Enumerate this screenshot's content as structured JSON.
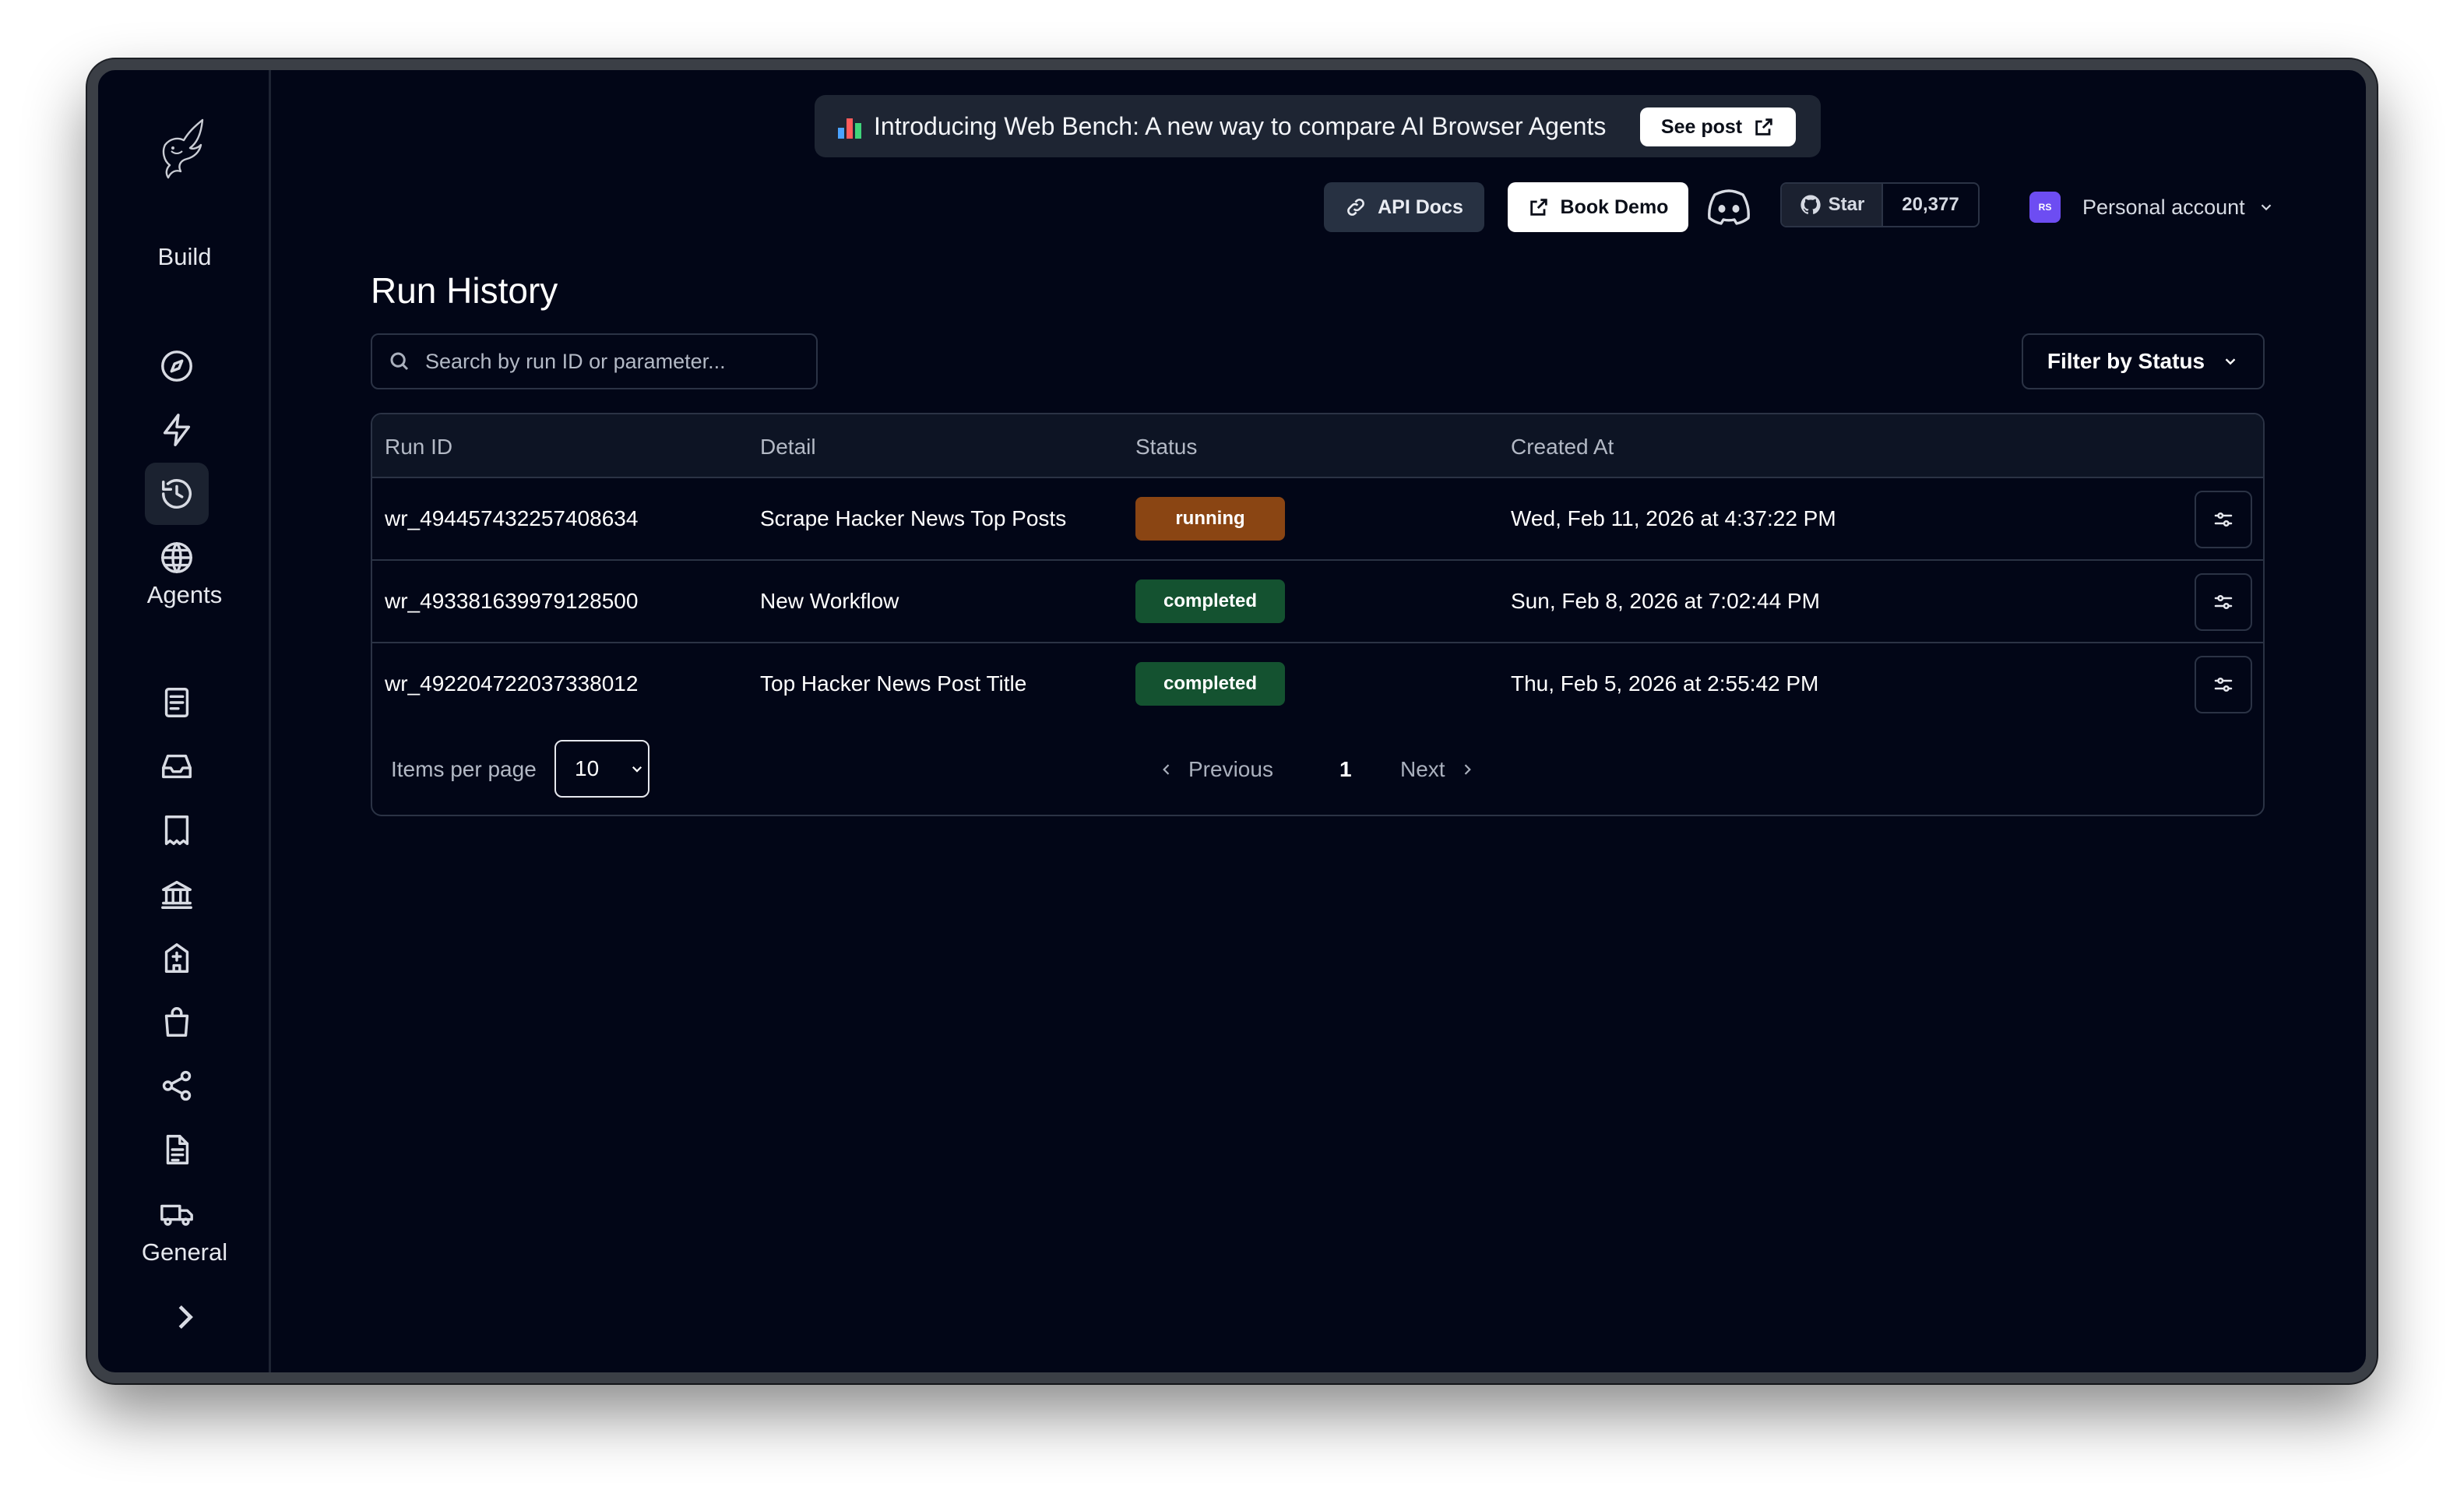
{
  "sidebar": {
    "sections": [
      "Build",
      "Agents",
      "General"
    ],
    "build_icons": [
      "compass-icon",
      "lightning-icon",
      "history-icon",
      "globe-icon"
    ],
    "agent_icons": [
      "document-icon",
      "inbox-icon",
      "receipt-icon",
      "bank-icon",
      "hospital-icon",
      "shopping-bag-icon",
      "share-icon",
      "file-text-icon",
      "truck-icon"
    ],
    "active_item": "history-icon"
  },
  "banner": {
    "text": "Introducing Web Bench: A new way to compare AI Browser Agents",
    "button_label": "See post"
  },
  "topbar": {
    "api_docs_label": "API Docs",
    "book_demo_label": "Book Demo",
    "star_label": "Star",
    "star_count": "20,377",
    "avatar_initials": "RS",
    "account_label": "Personal account"
  },
  "page": {
    "title": "Run History",
    "search_placeholder": "Search by run ID or parameter...",
    "filter_label": "Filter by Status"
  },
  "table": {
    "columns": [
      "Run ID",
      "Detail",
      "Status",
      "Created At"
    ],
    "rows": [
      {
        "run_id": "wr_494457432257408634",
        "detail": "Scrape Hacker News Top Posts",
        "status": "running",
        "created_at": "Wed, Feb 11, 2026 at 4:37:22 PM"
      },
      {
        "run_id": "wr_493381639979128500",
        "detail": "New Workflow",
        "status": "completed",
        "created_at": "Sun, Feb 8, 2026 at 7:02:44 PM"
      },
      {
        "run_id": "wr_492204722037338012",
        "detail": "Top Hacker News Post Title",
        "status": "completed",
        "created_at": "Thu, Feb 5, 2026 at 2:55:42 PM"
      }
    ]
  },
  "pagination": {
    "items_per_page_label": "Items per page",
    "items_per_page_value": "10",
    "previous_label": "Previous",
    "current_page": "1",
    "next_label": "Next"
  },
  "colors": {
    "background": "#020617",
    "running_badge": "#8a4513",
    "completed_badge": "#145230",
    "avatar": "#6d4df2"
  }
}
